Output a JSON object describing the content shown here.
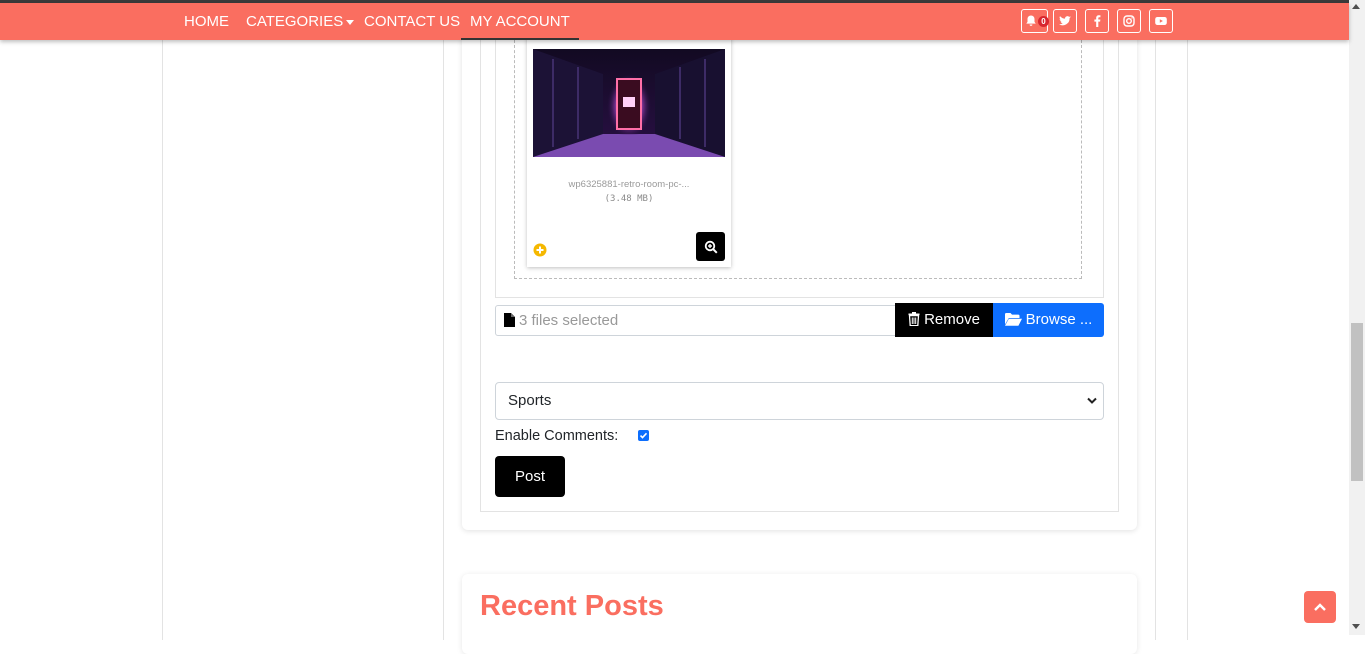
{
  "nav": {
    "items": [
      {
        "label": "HOME"
      },
      {
        "label": "CATEGORIES"
      },
      {
        "label": "CONTACT US"
      },
      {
        "label": "MY ACCOUNT"
      }
    ],
    "notification_count": "0",
    "social_icons": [
      "bell-icon",
      "twitter-icon",
      "facebook-icon",
      "instagram-icon",
      "youtube-icon"
    ]
  },
  "upload": {
    "thumbnail": {
      "file_name": "wp6325881-retro-room-pc-...",
      "file_size": "(3.48 MB)"
    },
    "file_input_text": "3 files selected",
    "remove_label": "Remove",
    "browse_label": "Browse ..."
  },
  "form": {
    "category_selected": "Sports",
    "comments_label": "Enable Comments:",
    "comments_enabled": true,
    "post_label": "Post"
  },
  "recent_posts": {
    "title": "Recent Posts"
  },
  "colors": {
    "brand": "#fa6e60",
    "primary": "#0d6efd",
    "dark": "#000000"
  }
}
